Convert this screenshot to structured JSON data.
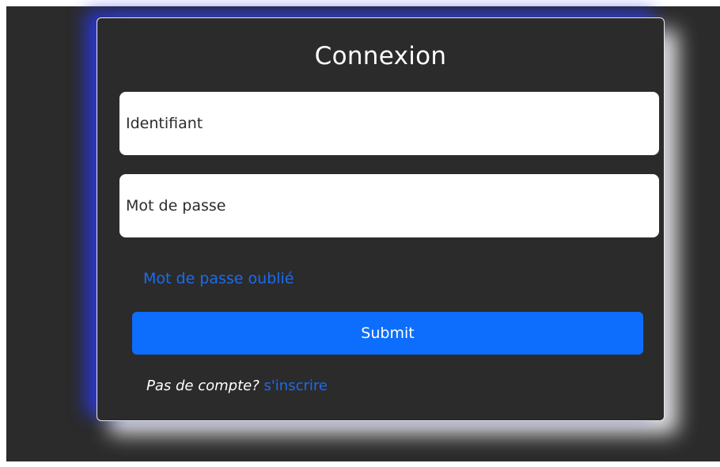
{
  "login": {
    "title": "Connexion",
    "username_placeholder": "Identifiant",
    "username_value": "",
    "password_placeholder": "Mot de passe",
    "password_value": "",
    "forgot_password_label": "Mot de passe oublié",
    "submit_label": "Submit",
    "no_account_label": "Pas de compte?",
    "signup_label": "s'inscrire"
  },
  "colors": {
    "background": "#2b2b2b",
    "accent_blue": "#0d6efd",
    "link_blue": "#1a6cf0",
    "glow_blue": "#2837e6",
    "field_background": "#ffffff",
    "text_light": "#ffffff"
  }
}
